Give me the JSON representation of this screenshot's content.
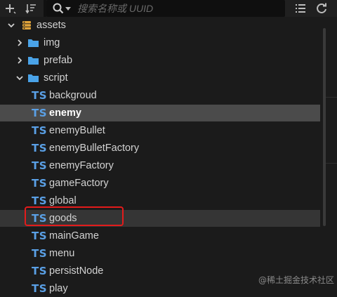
{
  "toolbar": {
    "add_icon": "plus-icon",
    "sort_icon": "sort-icon",
    "search": {
      "placeholder": "搜索名称或 UUID",
      "value": ""
    },
    "list_icon": "list-icon",
    "refresh_icon": "refresh-icon"
  },
  "tree": {
    "root": {
      "label": "assets",
      "icon": "database-icon",
      "expanded": true
    },
    "folders": [
      {
        "label": "img",
        "expanded": false
      },
      {
        "label": "prefab",
        "expanded": false
      },
      {
        "label": "script",
        "expanded": true
      }
    ],
    "ts_badge": "TS",
    "scripts": [
      {
        "label": "backgroud"
      },
      {
        "label": "enemy",
        "selected": true
      },
      {
        "label": "enemyBullet"
      },
      {
        "label": "enemyBulletFactory"
      },
      {
        "label": "enemyFactory"
      },
      {
        "label": "gameFactory"
      },
      {
        "label": "global"
      },
      {
        "label": "goods",
        "highlighted": true
      },
      {
        "label": "mainGame"
      },
      {
        "label": "menu"
      },
      {
        "label": "persistNode"
      },
      {
        "label": "play"
      }
    ]
  },
  "accent_colors": {
    "ts_badge": "#5aa0e6",
    "folder": "#4aa3e8",
    "highlight_box": "#e31b1b",
    "selected_row": "#4b4b4b"
  },
  "watermark": "@稀土掘金技术社区"
}
